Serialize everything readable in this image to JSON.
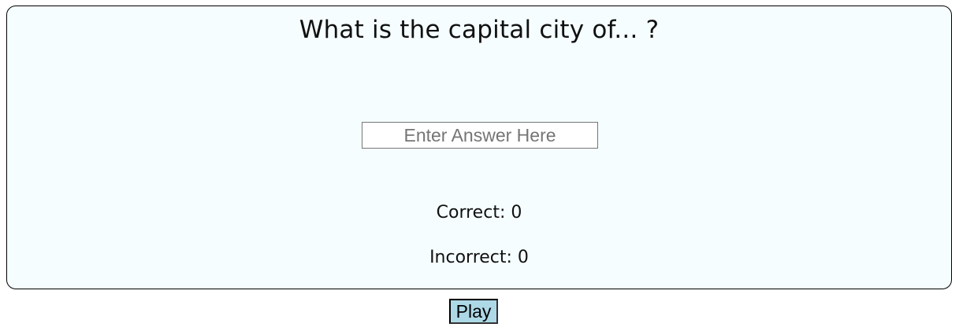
{
  "quiz": {
    "question": "What is the capital city of... ?",
    "answer_input": {
      "value": "",
      "placeholder": "Enter Answer Here"
    },
    "score": {
      "correct_label": "Correct: 0",
      "incorrect_label": "Incorrect: 0"
    }
  },
  "controls": {
    "play_label": "Play"
  },
  "colors": {
    "card_background": "#f5fdfe",
    "button_background": "#add8e6"
  }
}
